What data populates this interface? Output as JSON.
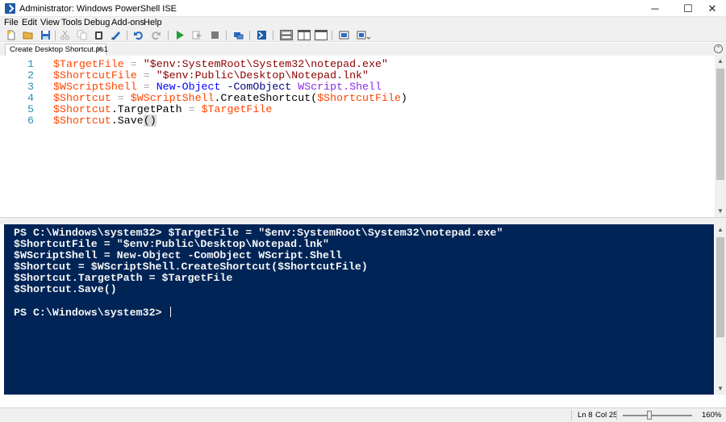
{
  "window": {
    "title": "Administrator: Windows PowerShell ISE",
    "minimize_glyph": "─",
    "maximize_glyph": "☐",
    "close_glyph": "✕"
  },
  "menu": [
    "File",
    "Edit",
    "View",
    "Tools",
    "Debug",
    "Add-ons",
    "Help"
  ],
  "toolbar_icons": [
    "new-icon",
    "open-icon",
    "save-icon",
    "cut-icon",
    "copy-icon",
    "paste-icon",
    "clear-console-icon",
    "undo-icon",
    "redo-icon",
    "run-icon",
    "run-selection-icon",
    "stop-icon",
    "remote-icon",
    "powershell-icon",
    "pane-top-icon",
    "pane-right-icon",
    "pane-max-icon",
    "show-commands-icon",
    "show-addon-icon"
  ],
  "tab": {
    "label": "Create Desktop Shortcut.ps1",
    "close_glyph": "✕"
  },
  "collapse_glyph": "⌃",
  "editor": {
    "line_numbers": [
      "1",
      "2",
      "3",
      "4",
      "5",
      "6"
    ],
    "lines": [
      [
        {
          "t": "$TargetFile",
          "c": "var"
        },
        {
          "t": " = ",
          "c": "op"
        },
        {
          "t": "\"$env:SystemRoot\\System32\\notepad.exe\"",
          "c": "str"
        }
      ],
      [
        {
          "t": "$ShortcutFile",
          "c": "var"
        },
        {
          "t": " = ",
          "c": "op"
        },
        {
          "t": "\"$env:Public\\Desktop\\Notepad.lnk\"",
          "c": "str"
        }
      ],
      [
        {
          "t": "$WScriptShell",
          "c": "var"
        },
        {
          "t": " = ",
          "c": "op"
        },
        {
          "t": "New-Object",
          "c": "cmd"
        },
        {
          "t": " -ComObject ",
          "c": "param"
        },
        {
          "t": "WScript.Shell",
          "c": "typ"
        }
      ],
      [
        {
          "t": "$Shortcut",
          "c": "var"
        },
        {
          "t": " = ",
          "c": "op"
        },
        {
          "t": "$WScriptShell",
          "c": "var"
        },
        {
          "t": ".CreateShortcut(",
          "c": "plain"
        },
        {
          "t": "$ShortcutFile",
          "c": "var"
        },
        {
          "t": ")",
          "c": "plain"
        }
      ],
      [
        {
          "t": "$Shortcut",
          "c": "var"
        },
        {
          "t": ".TargetPath",
          "c": "plain"
        },
        {
          "t": " = ",
          "c": "op"
        },
        {
          "t": "$TargetFile",
          "c": "var"
        }
      ],
      [
        {
          "t": "$Shortcut",
          "c": "var"
        },
        {
          "t": ".Save",
          "c": "plain"
        },
        {
          "t": "()",
          "c": "paren"
        }
      ]
    ]
  },
  "console": {
    "lines": [
      "PS C:\\Windows\\system32> $TargetFile = \"$env:SystemRoot\\System32\\notepad.exe\"",
      "$ShortcutFile = \"$env:Public\\Desktop\\Notepad.lnk\"",
      "$WScriptShell = New-Object -ComObject WScript.Shell",
      "$Shortcut = $WScriptShell.CreateShortcut($ShortcutFile)",
      "$Shortcut.TargetPath = $TargetFile",
      "$Shortcut.Save()",
      "",
      "PS C:\\Windows\\system32> "
    ]
  },
  "status": {
    "line": "Ln 8",
    "col": "Col 25",
    "zoom": "160%"
  },
  "colors": {
    "console_bg": "#012456",
    "variable": "#ff4500",
    "string": "#8b0000",
    "command": "#0000ff",
    "type": "#8a2be2",
    "line_number": "#2b91af"
  }
}
